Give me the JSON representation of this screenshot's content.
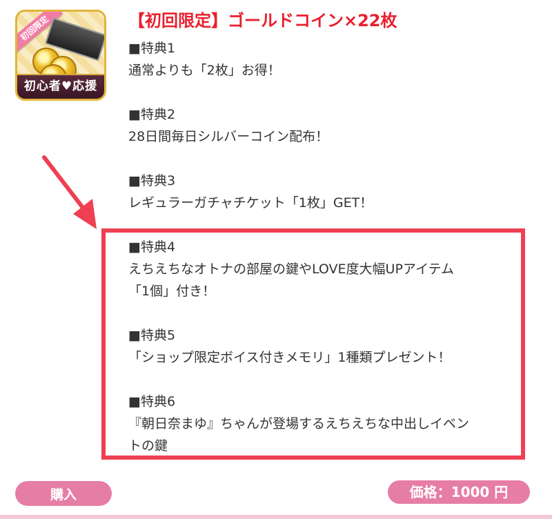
{
  "product": {
    "thumbnail_ribbon": "初回限定",
    "thumbnail_band": "初心者♥応援",
    "title": "【初回限定】ゴールドコイン×22枚"
  },
  "benefits": [
    {
      "heading": "■特典1",
      "lines": [
        "通常よりも「2枚」お得！"
      ]
    },
    {
      "heading": "■特典2",
      "lines": [
        "28日間毎日シルバーコイン配布！"
      ]
    },
    {
      "heading": "■特典3",
      "lines": [
        "レギュラーガチャチケット「1枚」GET！"
      ]
    },
    {
      "heading": "■特典4",
      "lines": [
        "えちえちなオトナの部屋の鍵やLOVE度大幅UPアイテム",
        "「1個」付き！"
      ]
    },
    {
      "heading": "■特典5",
      "lines": [
        "「ショップ限定ボイス付きメモリ」1種類プレゼント！"
      ]
    },
    {
      "heading": "■特典6",
      "lines": [
        "『朝日奈まゆ』ちゃんが登場するえちえちな中出しイベン",
        "トの鍵"
      ]
    }
  ],
  "footer": {
    "buy_label": "購入",
    "price_label": "価格：1000 円"
  },
  "colors": {
    "title_red": "#e8202e",
    "highlight_red": "#ef3f52",
    "button_pink": "#e67da4"
  }
}
